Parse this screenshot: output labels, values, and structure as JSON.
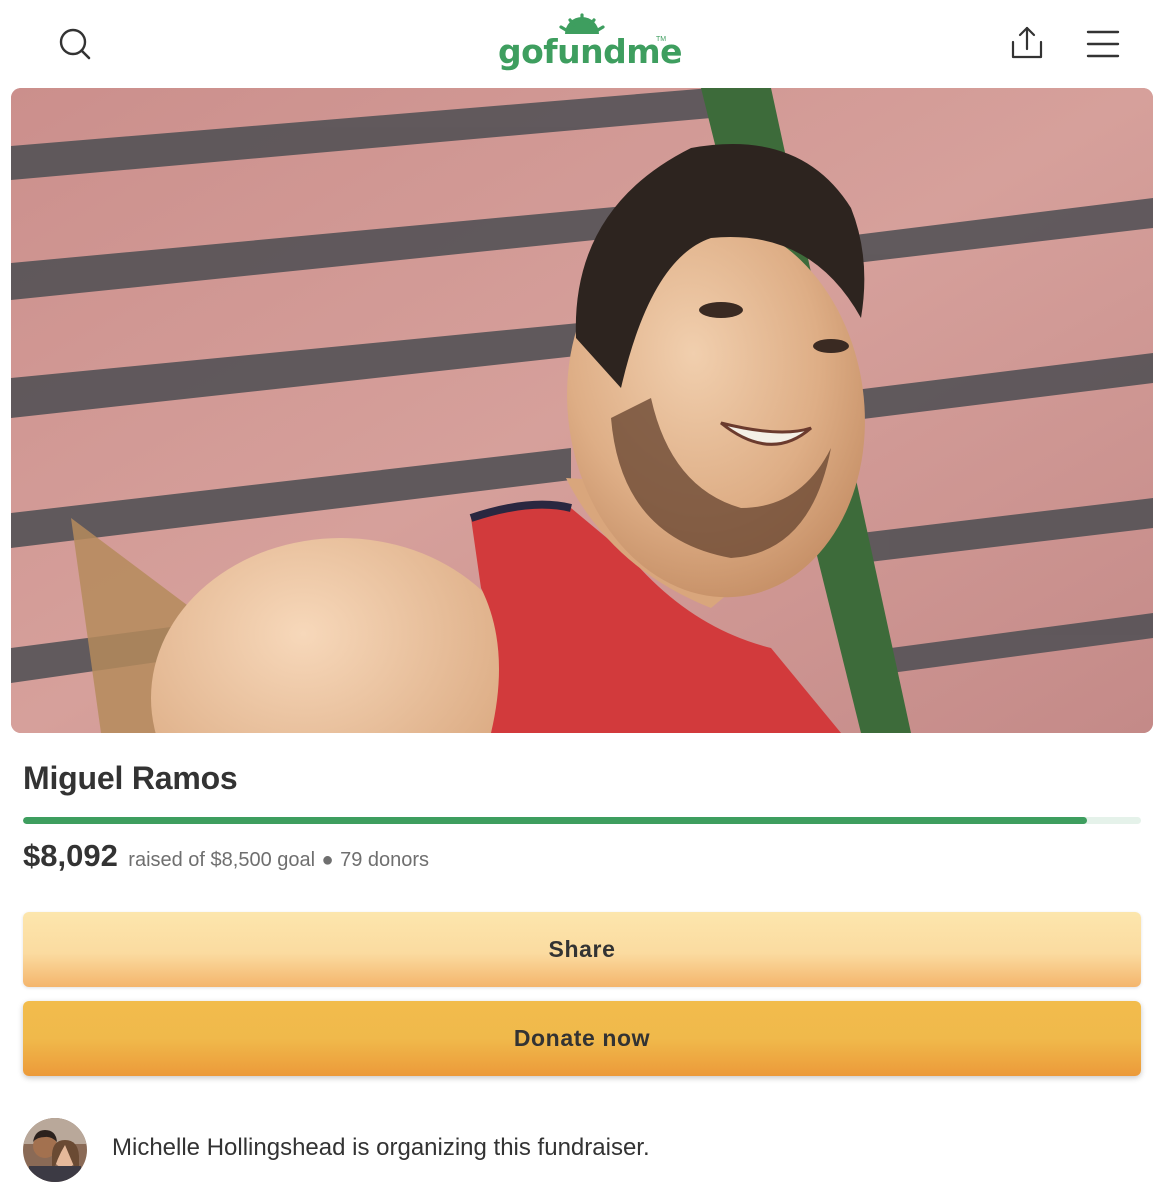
{
  "header": {
    "logo_text": "gofundme",
    "logo_tm": "TM",
    "brand_color": "#3e9e5f",
    "icons": [
      "search-icon",
      "share-upload-icon",
      "hamburger-menu-icon"
    ]
  },
  "campaign": {
    "title": "Miguel Ramos",
    "raised": "$8,092",
    "goal_text": "raised of $8,500 goal",
    "separator": "●",
    "donors": "79 donors",
    "progress_fraction": 0.952
  },
  "buttons": {
    "share_label": "Share",
    "donate_label": "Donate now"
  },
  "organizer": {
    "text": "Michelle Hollingshead is organizing this fundraiser."
  }
}
